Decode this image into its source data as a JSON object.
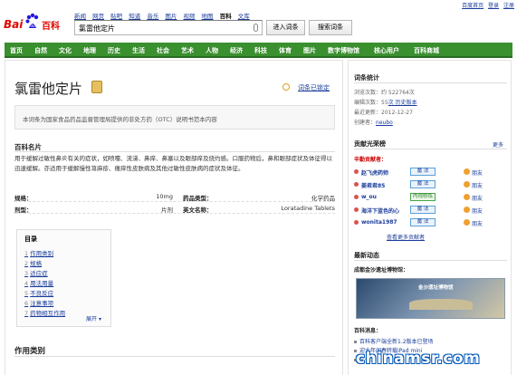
{
  "top_links": [
    "百度首页",
    "登录",
    "注册"
  ],
  "logo": {
    "bai": "Bai",
    "du": "du",
    "baike": "百科"
  },
  "search_nav": [
    "新闻",
    "网页",
    "贴吧",
    "知道",
    "音乐",
    "图片",
    "视频",
    "地图",
    "百科",
    "文库"
  ],
  "search": {
    "value": "氯雷他定片"
  },
  "buttons": {
    "enter": "进入词条",
    "search": "搜索词条"
  },
  "navbar": [
    "首页",
    "自然",
    "文化",
    "地理",
    "历史",
    "生活",
    "社会",
    "艺术",
    "人物",
    "经济",
    "科技",
    "体育",
    "图片",
    "数字博物馆",
    "核心用户",
    "百科商城"
  ],
  "article": {
    "title": "氯雷他定片",
    "locked": "词条已锁定",
    "notice": "本词条为国家食品药品监督管理局提供的非处方药（OTC）说明书范本内容",
    "name_heading": "百科名片",
    "summary": "用于缓解过敏性鼻炎有关的症状，如喷嚏、流涕、鼻痒、鼻塞以及眼部痒及烧灼感。口服药物后，鼻和眼部症状及体征得以迅速缓解。亦适用于缓解慢性荨麻疹、瘙痒性皮肤病及其他过敏性皮肤病的症状及体征。",
    "info": {
      "spec_label": "规格：",
      "spec_value": "10mg",
      "drug_type_label": "药品类型：",
      "drug_type_value": "化学药品",
      "form_label": "剂型：",
      "form_value": "片剂",
      "english_label": "英文名称：",
      "english_value": "Loratadine Tablets"
    },
    "toc": {
      "title": "目录",
      "items": [
        {
          "num": "1",
          "label": "作用类别"
        },
        {
          "num": "2",
          "label": "规格"
        },
        {
          "num": "3",
          "label": "适应症"
        },
        {
          "num": "4",
          "label": "用法用量"
        },
        {
          "num": "5",
          "label": "不良反应"
        },
        {
          "num": "6",
          "label": "注意事项"
        },
        {
          "num": "7",
          "label": "药物相互作用"
        }
      ],
      "expand": "展开"
    },
    "section1": "作用类别"
  },
  "sidebar": {
    "stats_heading": "词条统计",
    "stats": [
      {
        "label": "浏览次数：约 ",
        "value": "522764",
        "suffix": "次"
      },
      {
        "label": "编辑次数：",
        "value": "55",
        "suffix": "次 历史版本"
      },
      {
        "label": "最近更新：",
        "value": "2012-12-27",
        "suffix": ""
      },
      {
        "label": "创建者：",
        "value": "neubo",
        "suffix": ""
      }
    ],
    "contrib_heading": "贡献光荣榜",
    "contrib_more": "更多",
    "contrib_sub": "辛勤贡献者：",
    "contributors": [
      {
        "name": "赵飞虎药师",
        "badge": "魔 法",
        "green": false,
        "group": "朋友"
      },
      {
        "name": "姜君君85",
        "badge": "魔 法",
        "green": false,
        "group": "朋友"
      },
      {
        "name": "w_ou",
        "badge": "内视修炼",
        "green": true,
        "group": "朋友"
      },
      {
        "name": "海洋下蓝色的心",
        "badge": "魔 法",
        "green": false,
        "group": "朋友"
      },
      {
        "name": "wonita1987",
        "badge": "魔 法",
        "green": false,
        "group": "朋友"
      }
    ],
    "view_more": "查看更多贡献者",
    "latest_heading": "最新动态",
    "museum_heading": "成都金沙遗址博物馆：",
    "banner_text": "金沙遗址博物馆",
    "news_heading": "百科消息：",
    "news": [
      "百科客户端全新1.2版本已登场",
      "迎大年闹春转载iPad mini",
      "文豪..."
    ]
  },
  "watermark": "chinamsr.com"
}
